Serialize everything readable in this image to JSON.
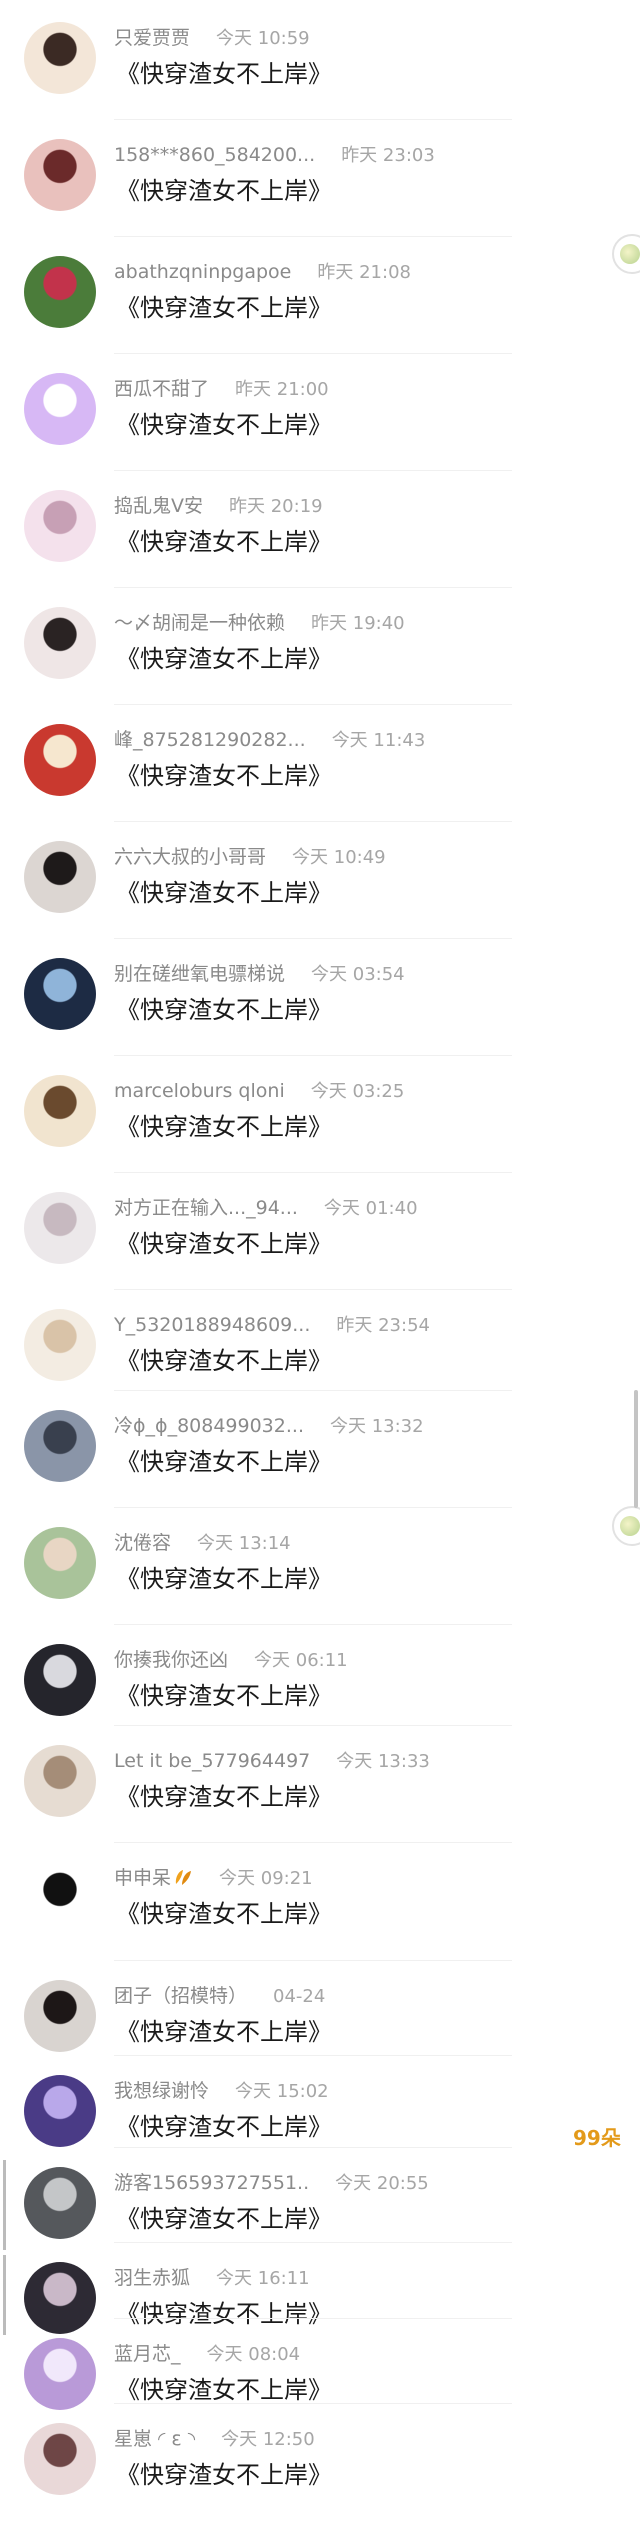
{
  "comments": [
    {
      "name": "只爱贾贾",
      "time": "今天 10:59",
      "message": "《快穿渣女不上岸》",
      "avatar_colors": [
        "#f3e6d8",
        "#3b2a24"
      ]
    },
    {
      "name": "158***860_584200...",
      "time": "昨天 23:03",
      "message": "《快穿渣女不上岸》",
      "avatar_colors": [
        "#e9c1bd",
        "#6b2a2a"
      ]
    },
    {
      "name": "abathzqninpgapoe",
      "time": "昨天 21:08",
      "message": "《快穿渣女不上岸》",
      "avatar_colors": [
        "#4b7c3a",
        "#c2334b"
      ]
    },
    {
      "name": "西瓜不甜了",
      "time": "昨天 21:00",
      "message": "《快穿渣女不上岸》",
      "avatar_colors": [
        "#d7b8f5",
        "#ffffff"
      ]
    },
    {
      "name": "捣乱鬼V安",
      "time": "昨天 20:19",
      "message": "《快穿渣女不上岸》",
      "avatar_colors": [
        "#f4e1ec",
        "#c7a0b5"
      ]
    },
    {
      "name": "～〆胡闹是一种依赖",
      "time": "昨天 19:40",
      "message": "《快穿渣女不上岸》",
      "avatar_colors": [
        "#efe6e6",
        "#2a2323"
      ]
    },
    {
      "name": "峰_875281290282...",
      "time": "今天 11:43",
      "message": "《快穿渣女不上岸》",
      "avatar_colors": [
        "#c9392f",
        "#f6e7cf"
      ]
    },
    {
      "name": "六六大叔的小哥哥",
      "time": "今天 10:49",
      "message": "《快穿渣女不上岸》",
      "avatar_colors": [
        "#dcd6d2",
        "#1e1a1a"
      ]
    },
    {
      "name": "别在磋绁氧电骠梯说",
      "time": "今天 03:54",
      "message": "《快穿渣女不上岸》",
      "avatar_colors": [
        "#1d2b44",
        "#8fb4d9"
      ]
    },
    {
      "name": "marceloburs qloni",
      "time": "今天 03:25",
      "message": "《快穿渣女不上岸》",
      "avatar_colors": [
        "#f1e4cf",
        "#6a4a2e"
      ]
    },
    {
      "name": "对方正在输入..._94...",
      "time": "今天 01:40",
      "message": "《快穿渣女不上岸》",
      "avatar_colors": [
        "#ece8ea",
        "#c7b9c0"
      ]
    },
    {
      "name": "Y_5320188948609...",
      "time": "昨天 23:54",
      "message": "《快穿渣女不上岸》",
      "avatar_colors": [
        "#f3ece2",
        "#d9c3a8"
      ]
    },
    {
      "name": "冷ɸ_ɸ_808499032...",
      "time": "今天 13:32",
      "message": "《快穿渣女不上岸》",
      "avatar_colors": [
        "#8a95a8",
        "#39404e"
      ]
    },
    {
      "name": "沈倦容",
      "time": "今天 13:14",
      "message": "《快穿渣女不上岸》",
      "avatar_colors": [
        "#a9c39a",
        "#e8d6c4"
      ]
    },
    {
      "name": "你揍我你还凶",
      "time": "今天 06:11",
      "message": "《快穿渣女不上岸》",
      "avatar_colors": [
        "#25252c",
        "#d9d9de"
      ]
    },
    {
      "name": "Let it be_577964497",
      "time": "今天 13:33",
      "message": "《快穿渣女不上岸》",
      "avatar_colors": [
        "#e6dcd2",
        "#a58d78"
      ]
    },
    {
      "name": "申申呆",
      "time": "今天 09:21",
      "message": "《快穿渣女不上岸》",
      "avatar_colors": [
        "#ffffff",
        "#111111"
      ],
      "emoji": "orange-leaves-icon"
    },
    {
      "name": "团子（招模特）",
      "time": "04-24",
      "message": "《快穿渣女不上岸》",
      "avatar_colors": [
        "#d9d4d0",
        "#1d1717"
      ]
    },
    {
      "name": "我想绿谢怜",
      "time": "今天 15:02",
      "message": "《快穿渣女不上岸》",
      "avatar_colors": [
        "#4a3b86",
        "#b9a8ea"
      ]
    },
    {
      "name": "游客156593727551..",
      "time": "今天 20:55",
      "message": "《快穿渣女不上岸》",
      "avatar_colors": [
        "#55585c",
        "#c4c6c8"
      ]
    },
    {
      "name": "羽生赤狐",
      "time": "今天 16:11",
      "message": "《快穿渣女不上岸》",
      "avatar_colors": [
        "#2d2a34",
        "#c9b8c8"
      ]
    },
    {
      "name": "蓝月芯_",
      "time": "今天 08:04",
      "message": "《快穿渣女不上岸》",
      "avatar_colors": [
        "#b99ad8",
        "#f1e8fb"
      ]
    },
    {
      "name": "星崽 ◜ ε ◝",
      "time": "今天 12:50",
      "message": "《快穿渣女不上岸》",
      "avatar_colors": [
        "#e9d8d8",
        "#6e4646"
      ]
    }
  ],
  "flower_count": "99朵",
  "colors": {
    "name": "#8a8a8a",
    "time": "#a6a6a6",
    "message": "#1a1a1a",
    "flower": "#e39a1a"
  }
}
